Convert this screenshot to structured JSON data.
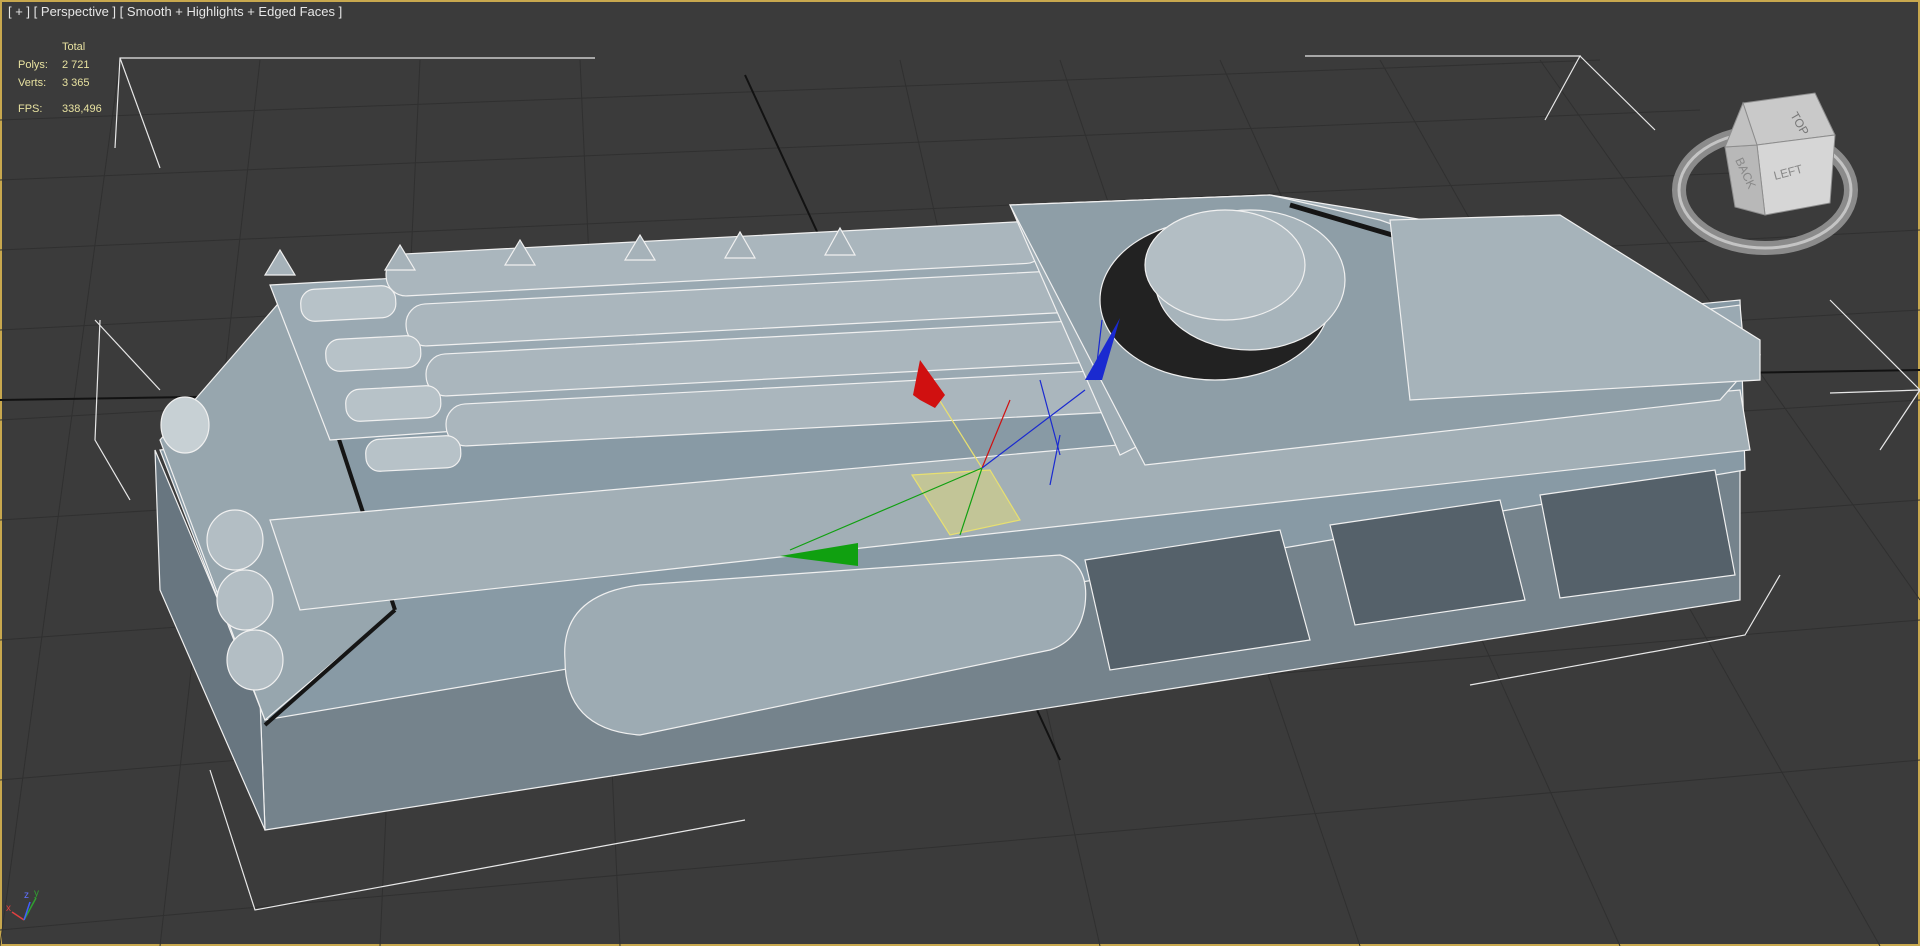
{
  "viewport": {
    "label_plus": "[ + ]",
    "label_view": "[ Perspective ]",
    "label_shading": "[ Smooth + Highlights + Edged Faces ]"
  },
  "stats": {
    "header": "Total",
    "polys_label": "Polys:",
    "polys_value": "2 721",
    "verts_label": "Verts:",
    "verts_value": "3 365",
    "fps_label": "FPS:",
    "fps_value": "338,496"
  },
  "viewcube": {
    "face_top": "TOP",
    "face_back": "BACK",
    "face_left": "LEFT"
  },
  "axis_tripod": {
    "x": "x",
    "y": "y",
    "z": "z"
  },
  "colors": {
    "viewport_bg": "#3b3b3b",
    "grid": "#2f2f2f",
    "grid_axis": "#111111",
    "model_face": "#8c9ca6",
    "model_edge": "#f2f2f2",
    "gizmo_x": "#d01010",
    "gizmo_y": "#10a010",
    "gizmo_z": "#1020d0",
    "gizmo_plane": "#e8e070",
    "stats_text": "#e8e2a0",
    "active_border": "#c8a84e"
  },
  "icons": [
    "viewcube-icon",
    "axis-tripod-icon",
    "transform-gizmo-icon"
  ]
}
